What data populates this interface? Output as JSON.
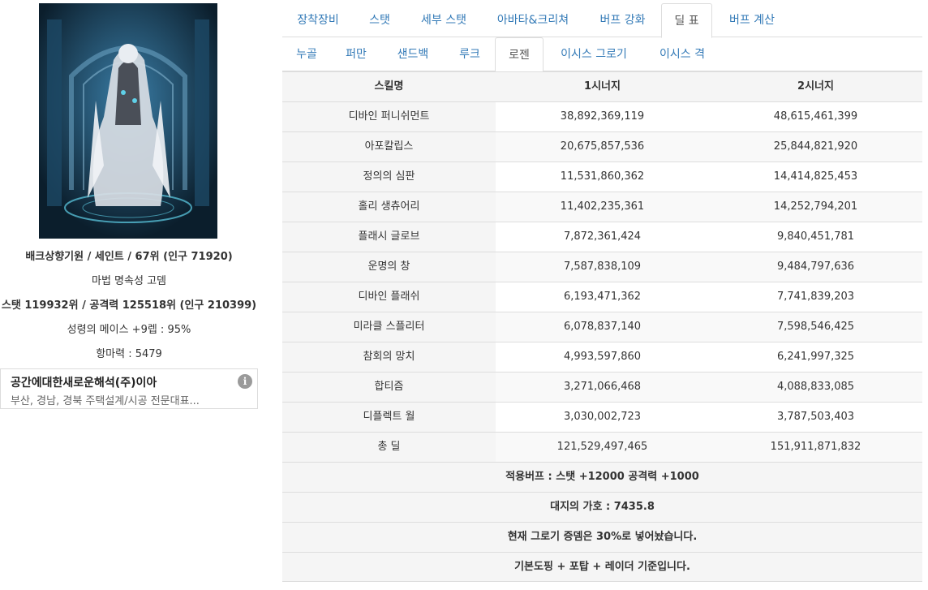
{
  "profile": {
    "line1": "배크상향기원 / 세인트 / 67위 (인구 71920)",
    "line2": "마법 명속성 고뎀",
    "line3": "스탯 119932위 / 공격력 125518위 (인구 210399)",
    "line4": "성령의 메이스 +9렙 : 95%",
    "line5": "항마력 : 5479"
  },
  "ad": {
    "title": "공간에대한새로운해석(주)이아",
    "description": "부산, 경남, 경북 주택설계/시공 전문대표...",
    "info_icon": "i"
  },
  "tabs_main": [
    {
      "label": "장착장비",
      "active": false
    },
    {
      "label": "스탯",
      "active": false
    },
    {
      "label": "세부 스탯",
      "active": false
    },
    {
      "label": "아바타&크리쳐",
      "active": false
    },
    {
      "label": "버프 강화",
      "active": false
    },
    {
      "label": "딜 표",
      "active": true
    },
    {
      "label": "버프 계산",
      "active": false
    }
  ],
  "tabs_sub": [
    {
      "label": "누골",
      "active": false
    },
    {
      "label": "퍼만",
      "active": false
    },
    {
      "label": "샌드백",
      "active": false
    },
    {
      "label": "루크",
      "active": false
    },
    {
      "label": "로젠",
      "active": true
    },
    {
      "label": "이시스 그로기",
      "active": false
    },
    {
      "label": "이시스 격",
      "active": false
    }
  ],
  "table": {
    "headers": [
      "스킬명",
      "1시너지",
      "2시너지"
    ],
    "rows": [
      [
        "디바인 퍼니쉬먼트",
        "38,892,369,119",
        "48,615,461,399"
      ],
      [
        "아포칼립스",
        "20,675,857,536",
        "25,844,821,920"
      ],
      [
        "정의의 심판",
        "11,531,860,362",
        "14,414,825,453"
      ],
      [
        "홀리 생츄어리",
        "11,402,235,361",
        "14,252,794,201"
      ],
      [
        "플래시 글로브",
        "7,872,361,424",
        "9,840,451,781"
      ],
      [
        "운명의 창",
        "7,587,838,109",
        "9,484,797,636"
      ],
      [
        "디바인 플래쉬",
        "6,193,471,362",
        "7,741,839,203"
      ],
      [
        "미라클 스플리터",
        "6,078,837,140",
        "7,598,546,425"
      ],
      [
        "참회의 망치",
        "4,993,597,860",
        "6,241,997,325"
      ],
      [
        "합티즘",
        "3,271,066,468",
        "4,088,833,085"
      ],
      [
        "디플렉트 월",
        "3,030,002,723",
        "3,787,503,403"
      ],
      [
        "총 딜",
        "121,529,497,465",
        "151,911,871,832"
      ]
    ],
    "notes": [
      "적용버프 : 스탯 +12000 공격력 +1000",
      "대지의 가호 : 7435.8",
      "현재 그로기 증뎀은 30%로 넣어놨습니다.",
      "기본도핑 + 포탑 + 레이더 기준입니다."
    ]
  }
}
